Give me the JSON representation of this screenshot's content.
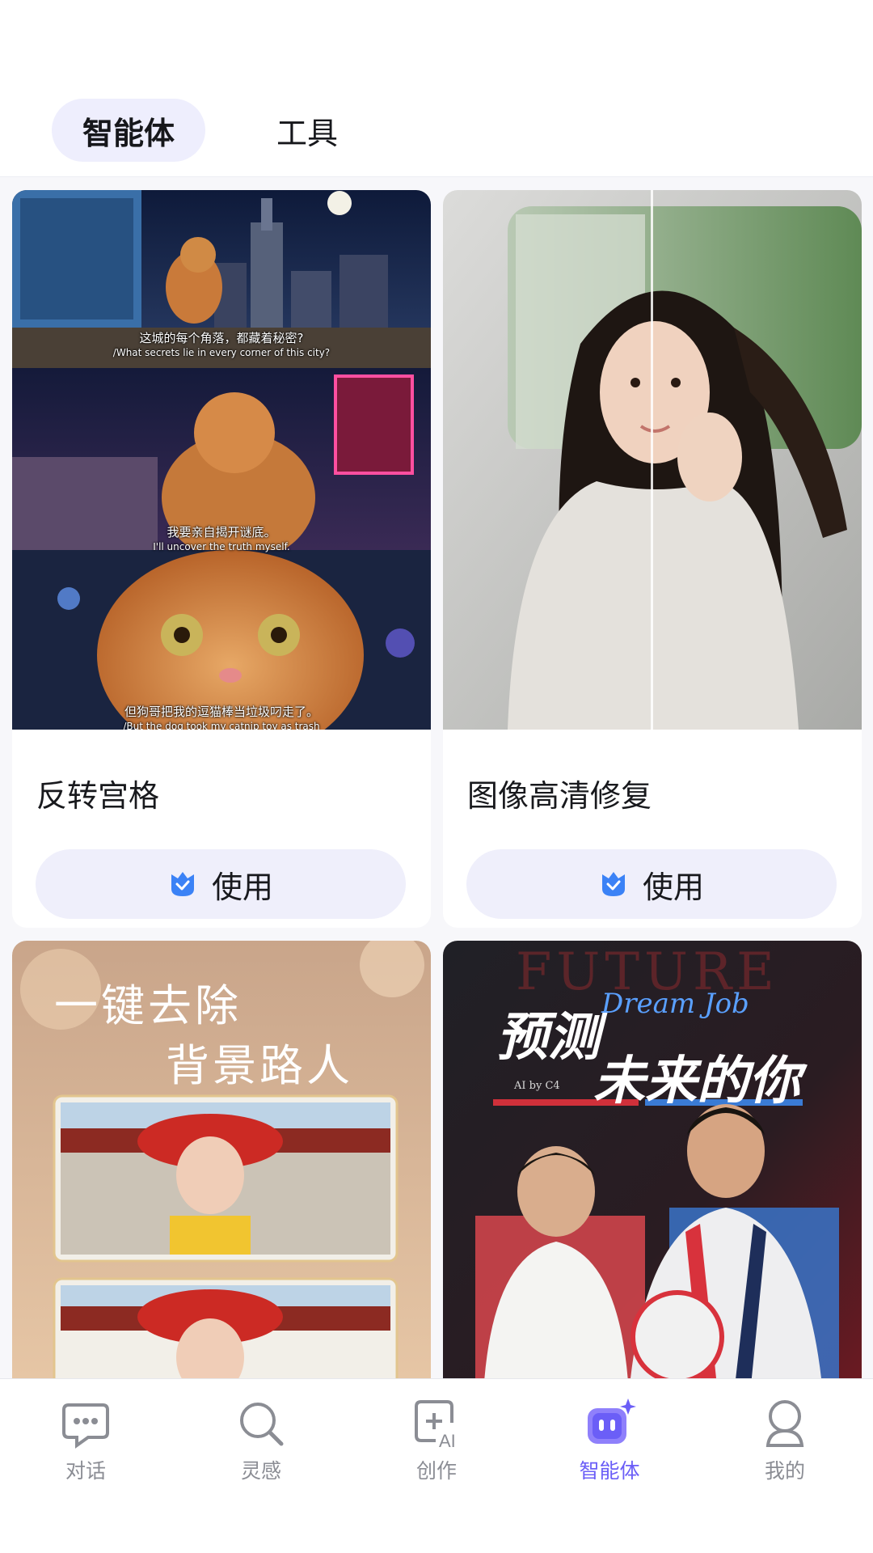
{
  "top_tabs": [
    {
      "label": "智能体",
      "active": true
    },
    {
      "label": "工具",
      "active": false
    }
  ],
  "cards": [
    {
      "title": "反转宫格",
      "button_label": "使用",
      "image_captions": [
        {
          "zh": "这城的每个角落，都藏着秘密?",
          "en": "/What secrets lie in every corner of this city?"
        },
        {
          "zh": "我要亲自揭开谜底。",
          "en": "I'll uncover the truth myself."
        },
        {
          "zh": "但狗哥把我的逗猫棒当垃圾叼走了。",
          "en": "/But the dog took my catnip toy as trash"
        }
      ]
    },
    {
      "title": "图像高清修复",
      "button_label": "使用"
    },
    {
      "image_text": {
        "line1": "一键去除",
        "line2": "背景路人"
      }
    },
    {
      "image_text": {
        "bg": "FUTURE",
        "line1": "预测",
        "line2": "未来的你",
        "script": "Dream Job",
        "credit": "AI by C4"
      }
    }
  ],
  "bottom_nav": [
    {
      "label": "对话",
      "icon": "chat-bubble-icon",
      "active": false
    },
    {
      "label": "灵感",
      "icon": "search-icon",
      "active": false
    },
    {
      "label": "创作",
      "icon": "ai-create-icon",
      "active": false
    },
    {
      "label": "智能体",
      "icon": "agent-robot-icon",
      "active": true
    },
    {
      "label": "我的",
      "icon": "profile-icon",
      "active": false
    }
  ],
  "colors": {
    "accent": "#6b5ef7",
    "tab_active_bg": "#eeeefd",
    "button_bg": "#efeffb",
    "badge_blue": "#3b82f6"
  }
}
